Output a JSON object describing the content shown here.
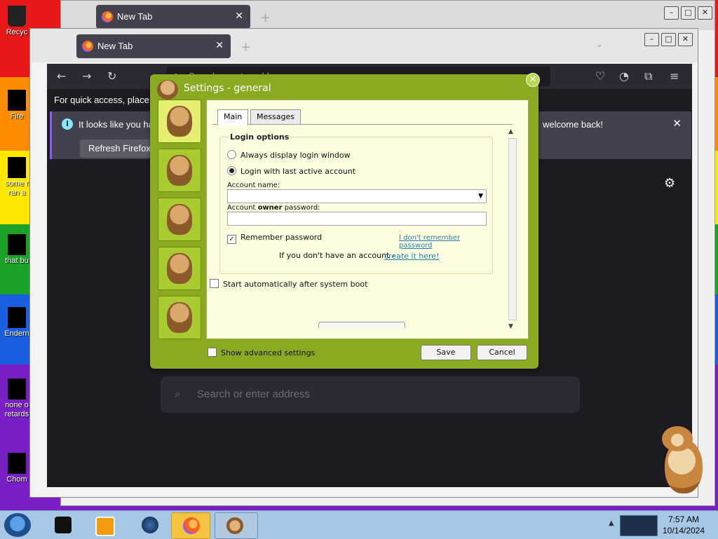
{
  "desktop": {
    "icons": [
      {
        "label": "Recyc"
      },
      {
        "label": "Fire"
      },
      {
        "label": "some r ran a"
      },
      {
        "label": "that bu"
      },
      {
        "label": "Endern"
      },
      {
        "label": "none o retards"
      },
      {
        "label": "Chom"
      }
    ]
  },
  "browser_back": {
    "tab_label": "New Tab",
    "tab_close": "✕"
  },
  "browser_front": {
    "tab_label": "New Tab",
    "tab_close": "✕",
    "url_placeholder": "Search or enter address",
    "bookmark_hint": "For quick access, place you",
    "notice_text": "It looks like you hav",
    "notice_text_end": "welcome back!",
    "refresh_button": "Refresh Firefox...",
    "search_placeholder": "Search or enter address"
  },
  "dialog": {
    "title": "Settings - general",
    "tabs": [
      "Main",
      "Messages"
    ],
    "group_title": "Login options",
    "radio_always": "Always display login window",
    "radio_last": "Login with last active account",
    "account_name_label": "Account name:",
    "owner_password_label_pre": "Account ",
    "owner_password_label_bold": "owner",
    "owner_password_label_post": " password:",
    "remember_password": "Remember password",
    "forgot_link": "I don't remember password",
    "no_account_text": "If you don't have an account - ",
    "create_link": "create it here!",
    "autostart": "Start automatically after system boot",
    "show_advanced": "Show advanced settings",
    "save_button": "Save",
    "cancel_button": "Cancel",
    "selected_radio": "last",
    "remember_checked": true,
    "autostart_checked": false,
    "advanced_checked": false
  },
  "taskbar": {
    "time": "7:57 AM",
    "date": "10/14/2024"
  },
  "colors": {
    "dialog_frame": "#8aaa22",
    "panel_bg": "#fdfde0",
    "ff_dark": "#1c1b22",
    "link": "#2a7fb0"
  }
}
